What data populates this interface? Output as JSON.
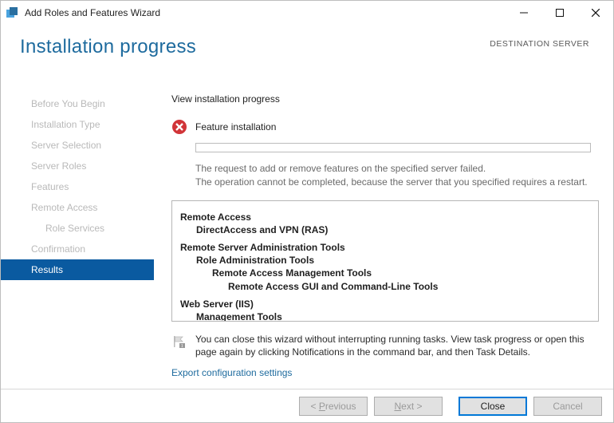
{
  "window": {
    "title": "Add Roles and Features Wizard"
  },
  "header": {
    "page_title": "Installation progress",
    "destination_label": "DESTINATION SERVER"
  },
  "sidebar": {
    "steps": [
      "Before You Begin",
      "Installation Type",
      "Server Selection",
      "Server Roles",
      "Features",
      "Remote Access",
      "Role Services",
      "Confirmation",
      "Results"
    ],
    "active_index": 8,
    "sub_indices": [
      6
    ]
  },
  "content": {
    "section_label": "View installation progress",
    "status_text": "Feature installation",
    "error_line1": "The request to add or remove features on the specified server failed.",
    "error_line2": "The operation cannot be completed, because the server that you specified requires a restart.",
    "features": [
      {
        "text": "Remote Access",
        "cls": "fb-top"
      },
      {
        "text": "DirectAccess and VPN (RAS)",
        "cls": "fb-1 fb-b"
      },
      {
        "text": "Remote Server Administration Tools",
        "cls": "fb-top"
      },
      {
        "text": "Role Administration Tools",
        "cls": "fb-1 fb-b"
      },
      {
        "text": "Remote Access Management Tools",
        "cls": "fb-2 fb-b"
      },
      {
        "text": "Remote Access GUI and Command-Line Tools",
        "cls": "fb-3 fb-b"
      },
      {
        "text": "Web Server (IIS)",
        "cls": "fb-top"
      },
      {
        "text": "Management Tools",
        "cls": "fb-1 fb-b"
      }
    ],
    "hint_text": "You can close this wizard without interrupting running tasks. View task progress or open this page again by clicking Notifications in the command bar, and then Task Details.",
    "export_link": "Export configuration settings"
  },
  "footer": {
    "previous": "< Previous",
    "next": "Next >",
    "close": "Close",
    "cancel": "Cancel"
  }
}
